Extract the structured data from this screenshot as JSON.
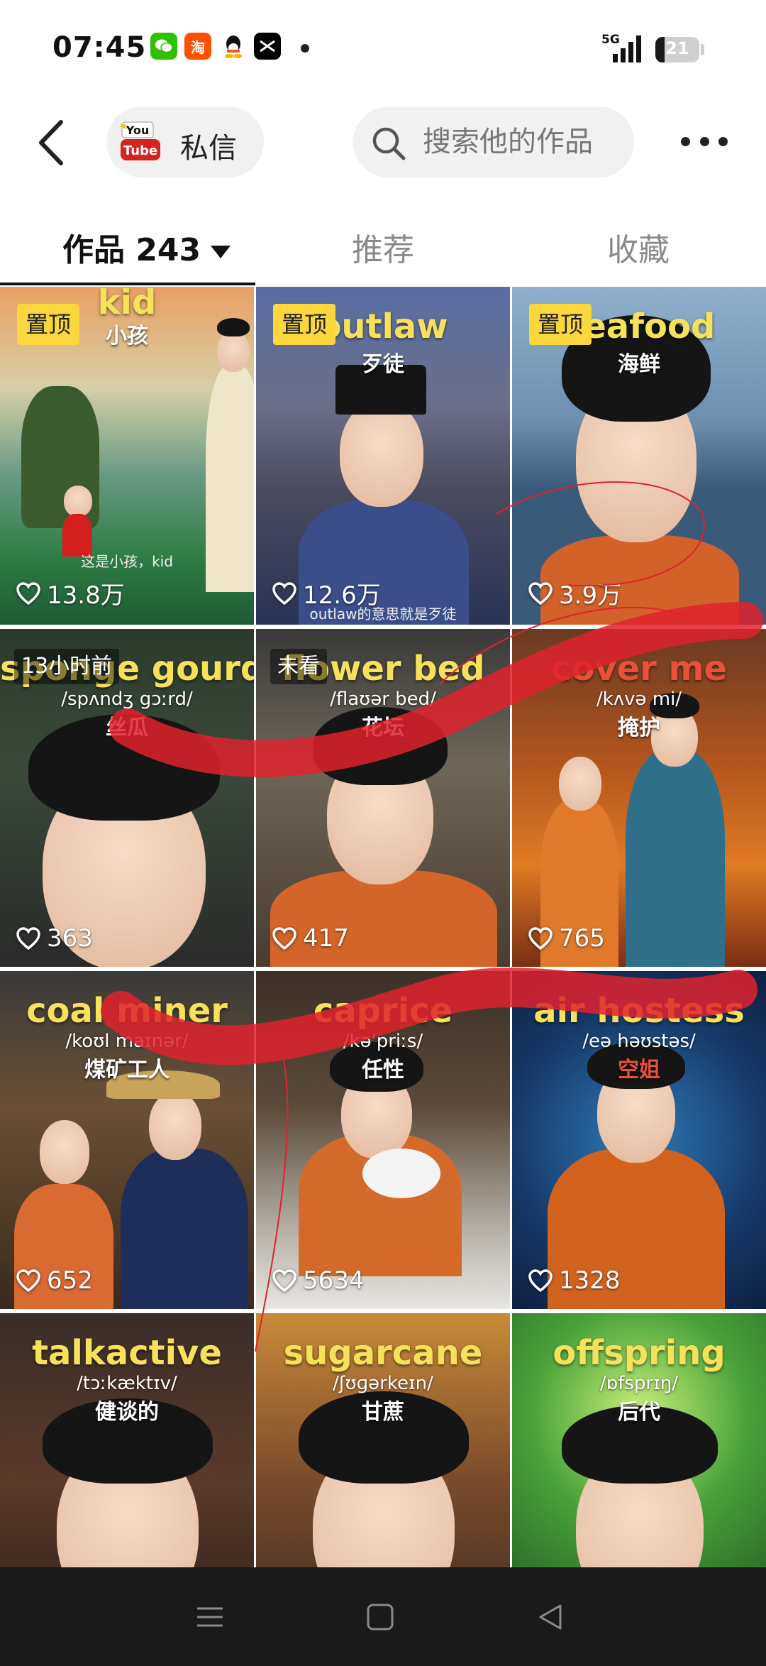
{
  "status_bar": {
    "time": "07:45",
    "network": "5G",
    "battery": "21",
    "battery_level": 0.21,
    "app_icons": [
      "wechat-icon",
      "taobao-icon",
      "qq-icon",
      "capcut-icon"
    ]
  },
  "header": {
    "dm_label": "私信",
    "search_placeholder": "搜索他的作品"
  },
  "tabs": {
    "works": "作品 243",
    "recommend": "推荐",
    "favorites": "收藏"
  },
  "videos": [
    {
      "eng": "kid",
      "ipa": "",
      "zh": "小孩",
      "badge": "置顶",
      "likes": "13.8万",
      "caption": "这是小孩，kid"
    },
    {
      "eng": "outlaw",
      "ipa": "",
      "zh": "歹徒",
      "badge": "置顶",
      "likes": "12.6万",
      "caption": "outlaw的意思就是歹徒"
    },
    {
      "eng": "seafood",
      "ipa": "",
      "zh": "海鲜",
      "badge": "置顶",
      "likes": "3.9万",
      "caption": ""
    },
    {
      "eng": "sponge gourd",
      "ipa": "/spʌndʒ gɔːrd/",
      "zh": "丝瓜",
      "time_badge": "13小时前",
      "likes": "363",
      "caption": ""
    },
    {
      "eng": "flower bed",
      "ipa": "/flaʊər bed/",
      "zh": "花坛",
      "time_badge": "未看",
      "likes": "417",
      "caption": ""
    },
    {
      "eng": "cover me",
      "ipa": "/kʌvə mi/",
      "zh": "掩护",
      "likes": "765",
      "caption": ""
    },
    {
      "eng": "coal miner",
      "ipa": "/koʊl maɪnər/",
      "zh": "煤矿工人",
      "likes": "652",
      "caption": ""
    },
    {
      "eng": "caprice",
      "ipa": "/kəˈpriːs/",
      "zh": "任性",
      "likes": "5634",
      "caption": ""
    },
    {
      "eng": "air hostess",
      "ipa": "/eə həʊstəs/",
      "zh": "空姐",
      "likes": "1328",
      "caption": ""
    },
    {
      "eng": "talkactive",
      "ipa": "/tɔːkæktɪv/",
      "zh": "健谈的",
      "likes": "",
      "caption": ""
    },
    {
      "eng": "sugarcane",
      "ipa": "/ʃʊɡərkeɪn/",
      "zh": "甘蔗",
      "likes": "",
      "caption": ""
    },
    {
      "eng": "offspring",
      "ipa": "/ɒfsprɪŋ/",
      "zh": "后代",
      "likes": "",
      "caption": ""
    }
  ],
  "colors": {
    "badge_yellow": "#fbd63c",
    "title_yellow": "#f6e25a",
    "scribble_red": "#e0222d",
    "nav_bar": "#1a1a1a"
  }
}
